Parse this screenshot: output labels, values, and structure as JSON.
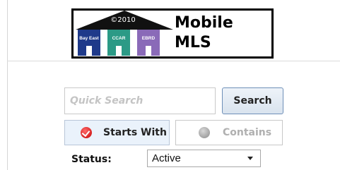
{
  "logo": {
    "copyright": "©2010",
    "houses": [
      {
        "label": "Bay East",
        "color": "#1f3a8a"
      },
      {
        "label": "CCAR",
        "color": "#2c9a86"
      },
      {
        "label": "EBRD",
        "color": "#8a6ab8"
      }
    ],
    "title_line1": "Mobile",
    "title_line2": "MLS"
  },
  "search": {
    "placeholder": "Quick Search",
    "value": "",
    "button_label": "Search"
  },
  "match_mode": {
    "selected": "Starts With",
    "options": [
      {
        "label": "Starts With",
        "icon": "checked-radio-icon",
        "state": "selected"
      },
      {
        "label": "Contains",
        "icon": "unchecked-radio-icon",
        "state": "unselected"
      }
    ]
  },
  "status": {
    "label": "Status:",
    "selected": "Active"
  }
}
